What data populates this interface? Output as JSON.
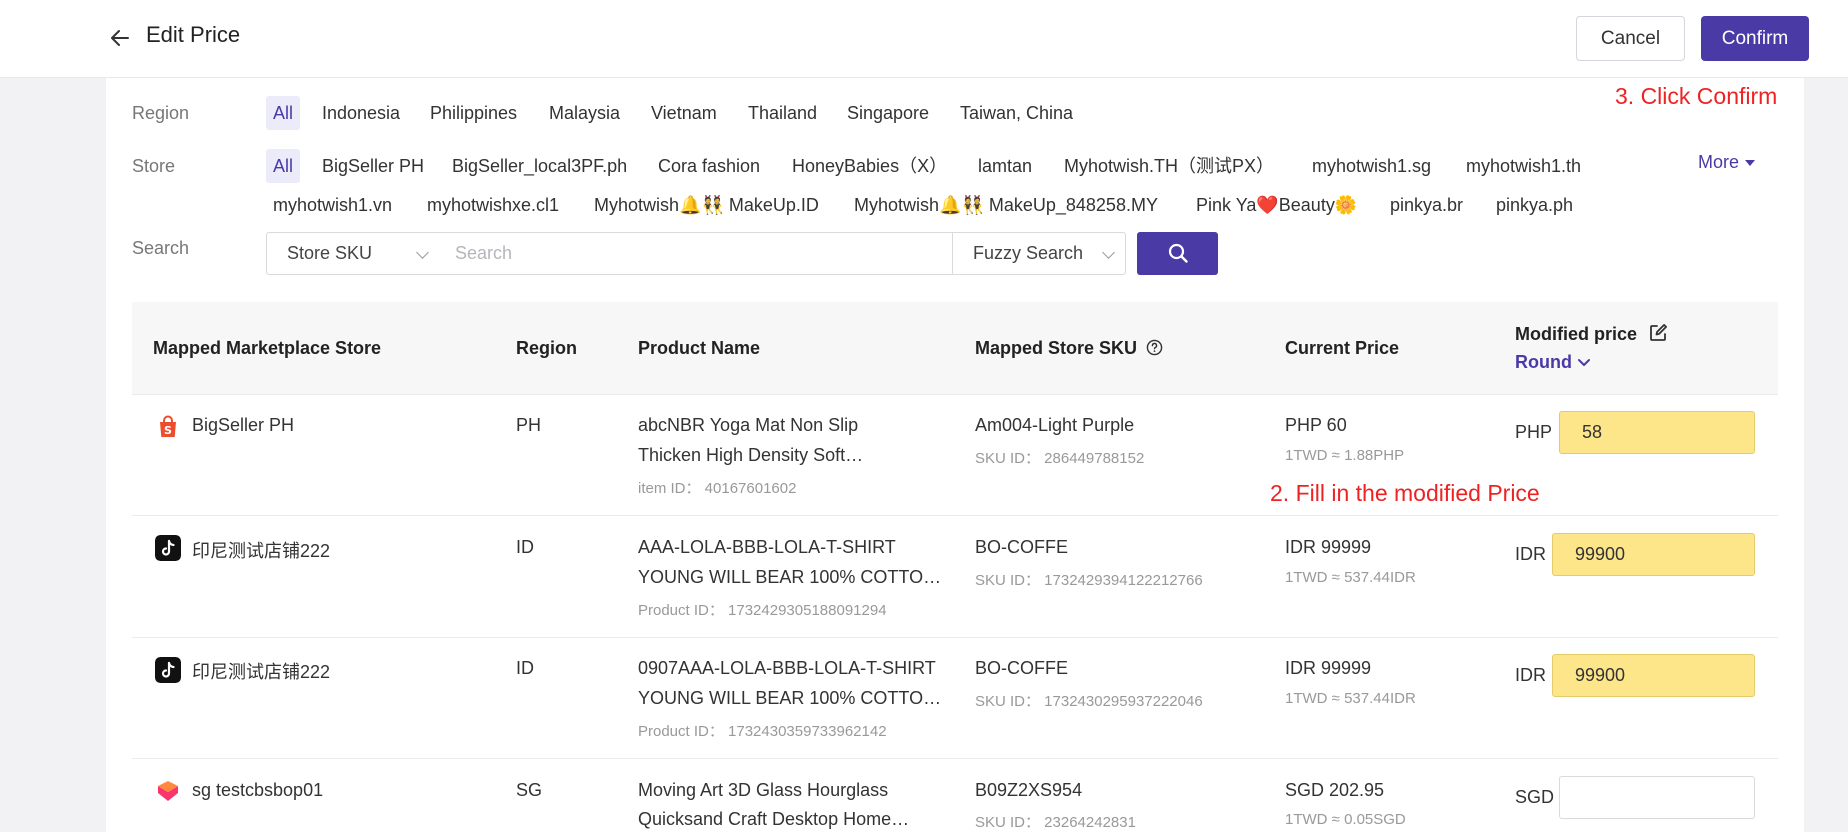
{
  "header": {
    "title": "Edit Price",
    "cancel_label": "Cancel",
    "confirm_label": "Confirm"
  },
  "annotations": {
    "confirm_hint": "3. Click Confirm",
    "fill_hint": "2. Fill in the modified Price"
  },
  "filters": {
    "region_label": "Region",
    "regions": [
      "All",
      "Indonesia",
      "Philippines",
      "Malaysia",
      "Vietnam",
      "Thailand",
      "Singapore",
      "Taiwan, China"
    ],
    "store_label": "Store",
    "stores_row1": [
      "All",
      "BigSeller PH",
      "BigSeller_local3PF.ph",
      "Cora fashion",
      "HoneyBabies（X）",
      "lamtan",
      "Myhotwish.TH（测试PX）",
      "myhotwish1.sg",
      "myhotwish1.th"
    ],
    "stores_row2": [
      "myhotwish1.vn",
      "myhotwishxe.cl1",
      "Myhotwish🔔👯 MakeUp.ID",
      "Myhotwish🔔👯 MakeUp_848258.MY",
      "Pink Ya❤️Beauty🌼",
      "pinkya.br",
      "pinkya.ph"
    ],
    "more_label": "More",
    "search_label": "Search",
    "search_field_value": "Store SKU",
    "search_placeholder": "Search",
    "search_mode_value": "Fuzzy Search"
  },
  "table": {
    "columns": [
      "Mapped Marketplace Store",
      "Region",
      "Product Name",
      "Mapped Store SKU",
      "Current Price",
      "Modified price"
    ],
    "round_label": "Round",
    "rows": [
      {
        "store": "BigSeller PH",
        "store_platform": "shopee-icon",
        "region": "PH",
        "product_line1": "abcNBR Yoga Mat Non Slip",
        "product_line2": "Thicken High Density Soft…",
        "product_id": "item ID：  40167601602",
        "sku": "Am004-Light Purple",
        "sku_id": "SKU ID：  286449788152",
        "current_price": "PHP 60",
        "rate": "1TWD ≈ 1.88PHP",
        "currency": "PHP",
        "modified": "58"
      },
      {
        "store": "印尼测试店铺222",
        "store_platform": "tiktok-icon",
        "region": "ID",
        "product_line1": "AAA-LOLA-BBB-LOLA-T-SHIRT",
        "product_line2": "YOUNG WILL BEAR 100% COTTO…",
        "product_id": "Product ID：  1732429305188091294",
        "sku": "BO-COFFE",
        "sku_id": "SKU ID：  1732429394122212766",
        "current_price": "IDR 99999",
        "rate": "1TWD ≈ 537.44IDR",
        "currency": "IDR",
        "modified": "99900"
      },
      {
        "store": "印尼测试店铺222",
        "store_platform": "tiktok-icon",
        "region": "ID",
        "product_line1": "0907AAA-LOLA-BBB-LOLA-T-SHIRT",
        "product_line2": "YOUNG WILL BEAR 100% COTTO…",
        "product_id": "Product ID：  1732430359733962142",
        "sku": "BO-COFFE",
        "sku_id": "SKU ID：  1732430295937222046",
        "current_price": "IDR 99999",
        "rate": "1TWD ≈ 537.44IDR",
        "currency": "IDR",
        "modified": "99900"
      },
      {
        "store": "sg testcbsbop01",
        "store_platform": "lazada-icon",
        "region": "SG",
        "product_line1": "Moving Art 3D Glass Hourglass",
        "product_line2": "Quicksand Craft Desktop Home…",
        "sku": "B09Z2XS954",
        "sku_id": "SKU ID：  23264242831",
        "current_price": "SGD 202.95",
        "rate": "1TWD ≈ 0.05SGD",
        "currency": "SGD",
        "modified": ""
      }
    ]
  },
  "colors": {
    "accent": "#4a3aa6",
    "highlight": "#fde58a",
    "annotation": "#ee2222"
  }
}
